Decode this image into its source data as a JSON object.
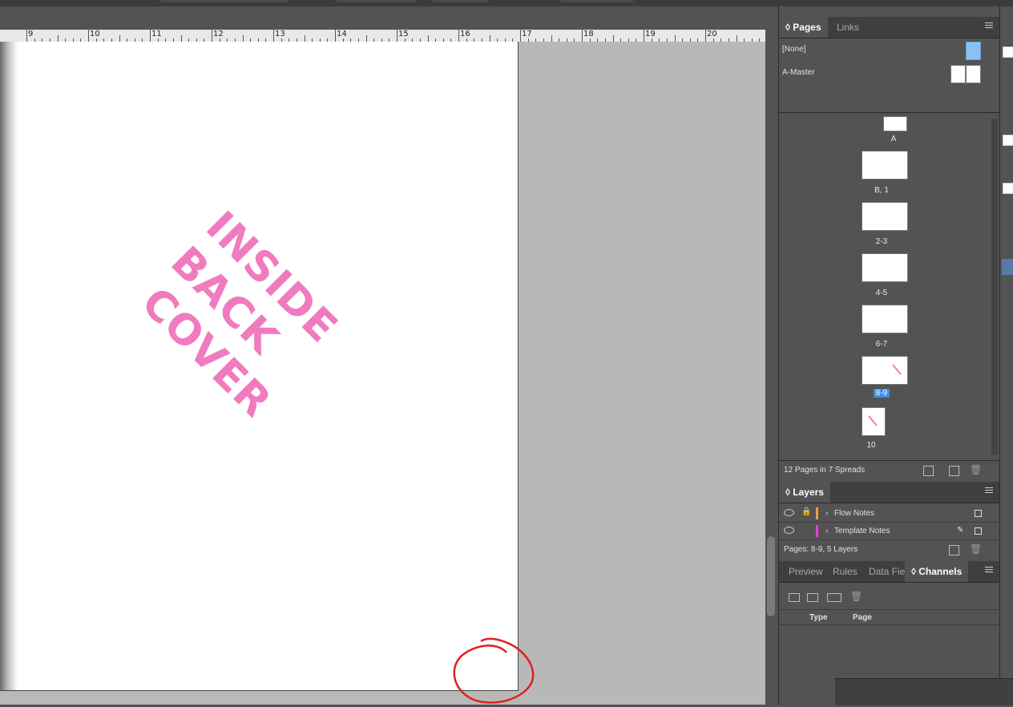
{
  "ruler": {
    "labels": [
      "9",
      "10",
      "11",
      "12",
      "13",
      "14",
      "15",
      "16",
      "17",
      "18",
      "19",
      "20"
    ]
  },
  "document": {
    "watermark_line1": "INSIDE BACK",
    "watermark_line2": "COVER"
  },
  "pages_panel": {
    "tabs": [
      {
        "label": "Pages"
      },
      {
        "label": "Links"
      }
    ],
    "masters": [
      {
        "label": "[None]"
      },
      {
        "label": "A-Master"
      }
    ],
    "master_prefix": "A",
    "spreads": [
      {
        "label": "B, 1"
      },
      {
        "label": "2-3"
      },
      {
        "label": "4-5"
      },
      {
        "label": "6-7"
      },
      {
        "label": "8-9"
      },
      {
        "label": "10"
      }
    ],
    "status": "12 Pages in 7 Spreads"
  },
  "layers_panel": {
    "title": "Layers",
    "layers": [
      {
        "name": "Flow Notes",
        "color": "#e8a04a"
      },
      {
        "name": "Template Notes",
        "color": "#e040e0"
      }
    ],
    "status": "Pages: 8-9, 5 Layers"
  },
  "channels_panel": {
    "tabs": [
      {
        "label": "Preview"
      },
      {
        "label": "Rules"
      },
      {
        "label": "Data Fie"
      },
      {
        "label": "Channels"
      }
    ],
    "columns": [
      {
        "label": "Type"
      },
      {
        "label": "Page"
      }
    ]
  },
  "colors": {
    "accent_selected": "#3a8ee6",
    "watermark": "#f07bbf",
    "annotation": "#e02020"
  }
}
